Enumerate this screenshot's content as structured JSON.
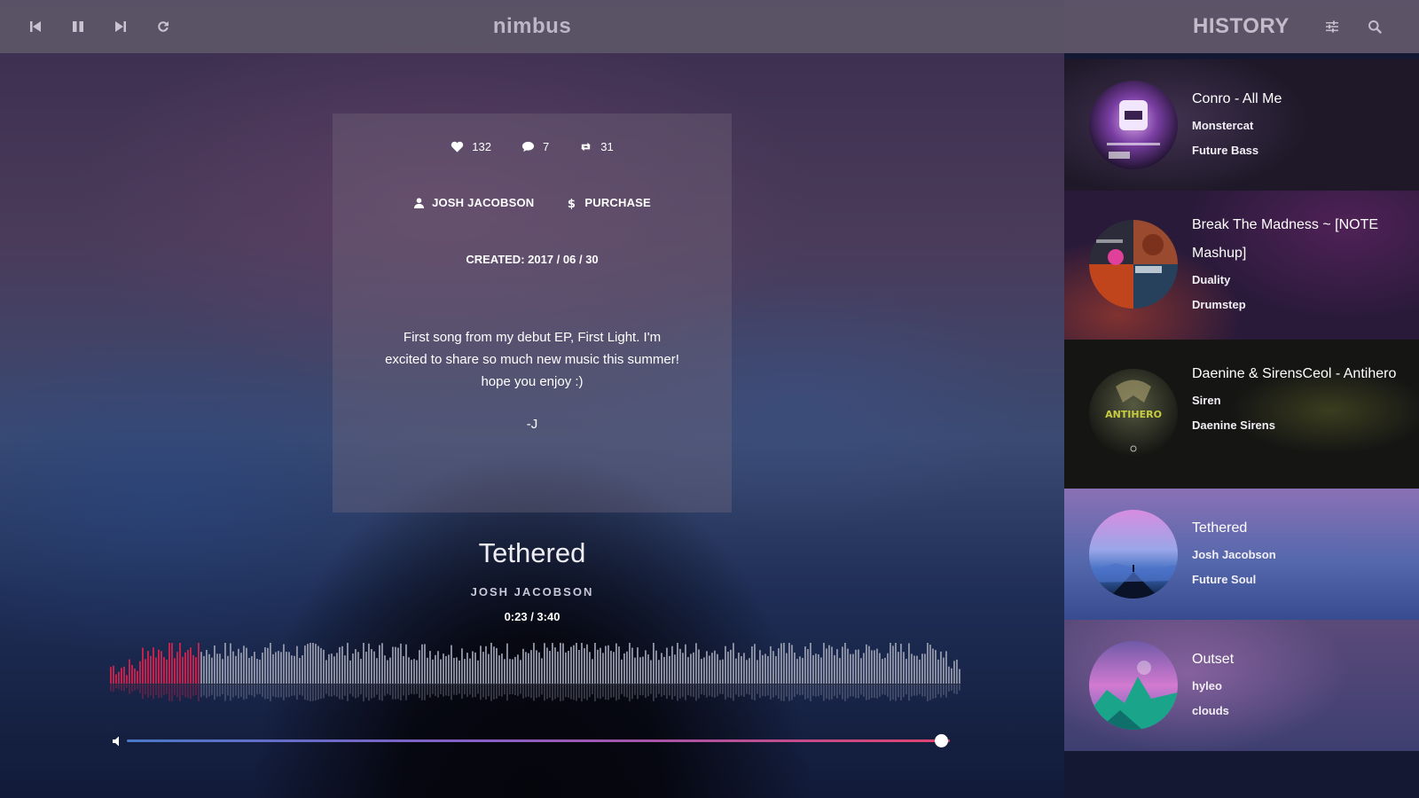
{
  "app": {
    "name": "nimbus"
  },
  "header": {
    "history_title": "HISTORY"
  },
  "player_controls": {
    "prev_icon": "skip-back-icon",
    "pause_icon": "pause-icon",
    "next_icon": "skip-forward-icon",
    "repeat_icon": "repeat-icon"
  },
  "history_toolbar": {
    "settings_icon": "sliders-icon",
    "search_icon": "search-icon"
  },
  "info": {
    "likes": "132",
    "comments": "7",
    "reposts": "31",
    "artist_link": "JOSH JACOBSON",
    "purchase_label": "PURCHASE",
    "created": "CREATED: 2017 / 06 / 30",
    "description": "First song from my debut EP, First Light. I'm excited to share so much new music this summer! hope you enjoy :)",
    "signature": "-J"
  },
  "now_playing": {
    "title": "Tethered",
    "artist": "JOSH JACOBSON",
    "time": "0:23 / 3:40",
    "progress": 0.105,
    "volume": 0.99
  },
  "colors": {
    "accent_played": "#c8244f",
    "unplayed": "#8f93a6",
    "slider_start": "#4a78c9",
    "slider_end": "#e0436d"
  },
  "history": [
    {
      "title": "Conro - All Me",
      "line1": "Monstercat",
      "line2": "Future Bass"
    },
    {
      "title": "Break The Madness ~ [NOTE Mashup]",
      "line1": "Duality",
      "line2": "Drumstep"
    },
    {
      "title": "Daenine & SirensCeol - Antihero",
      "line1": "Siren",
      "line2": "Daenine Sirens"
    },
    {
      "title": "Tethered",
      "line1": "Josh Jacobson",
      "line2": "Future Soul"
    },
    {
      "title": "Outset",
      "line1": "hyleo",
      "line2": "clouds"
    }
  ]
}
